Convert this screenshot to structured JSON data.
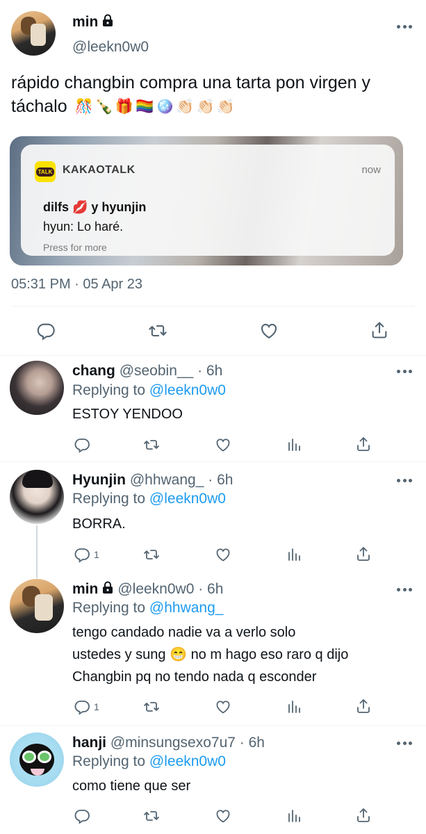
{
  "main_tweet": {
    "name": "min",
    "handle": "@leekn0w0",
    "text": "rápido changbin compra una tarta pon virgen y táchalo",
    "emojis": [
      "🎊",
      "🍾",
      "🎁",
      "🏳️‍🌈",
      "🪩",
      "👏🏻",
      "👏🏻",
      "👏🏻"
    ],
    "timestamp": "05:31 PM · 05 Apr 23",
    "notification": {
      "app": "KAKAOTALK",
      "logo_text": "TALK",
      "time": "now",
      "title": "dilfs 💋 y hyunjin",
      "body": "hyun: Lo haré.",
      "hint": "Press for more"
    }
  },
  "replies": [
    {
      "name": "chang",
      "handle": "@seobin__ · 6h",
      "replying_prefix": "Replying to",
      "replying_to": "@leekn0w0",
      "text": "ESTOY YENDOO",
      "reply_count": ""
    },
    {
      "name": "Hyunjin",
      "handle": "@hhwang_ · 6h",
      "replying_prefix": "Replying to",
      "replying_to": "@leekn0w0",
      "text": "BORRA.",
      "reply_count": "1"
    },
    {
      "name": "min",
      "handle": "@leekn0w0 · 6h",
      "replying_prefix": "Replying to",
      "replying_to": "@hhwang_",
      "text_line1": "tengo candado nadie va a verlo solo",
      "text_line2a": "ustedes y sung",
      "text_emoji": "😁",
      "text_line2b": "no m hago eso raro q dijo",
      "text_line3": "Changbin pq no tendo nada q esconder",
      "reply_count": "1"
    },
    {
      "name": "hanji",
      "handle": "@minsungsexo7u7 · 6h",
      "replying_prefix": "Replying to",
      "replying_to": "@leekn0w0",
      "text": "como tiene que ser",
      "reply_count": ""
    }
  ],
  "colors": {
    "text": "#0f1419",
    "secondary": "#536471",
    "link": "#1d9bf0",
    "divider": "#eff3f4",
    "kakao_yellow": "#fae100"
  },
  "icons": [
    "more-icon",
    "lock-icon",
    "reply-icon",
    "retweet-icon",
    "like-icon",
    "share-icon",
    "analytics-icon"
  ]
}
